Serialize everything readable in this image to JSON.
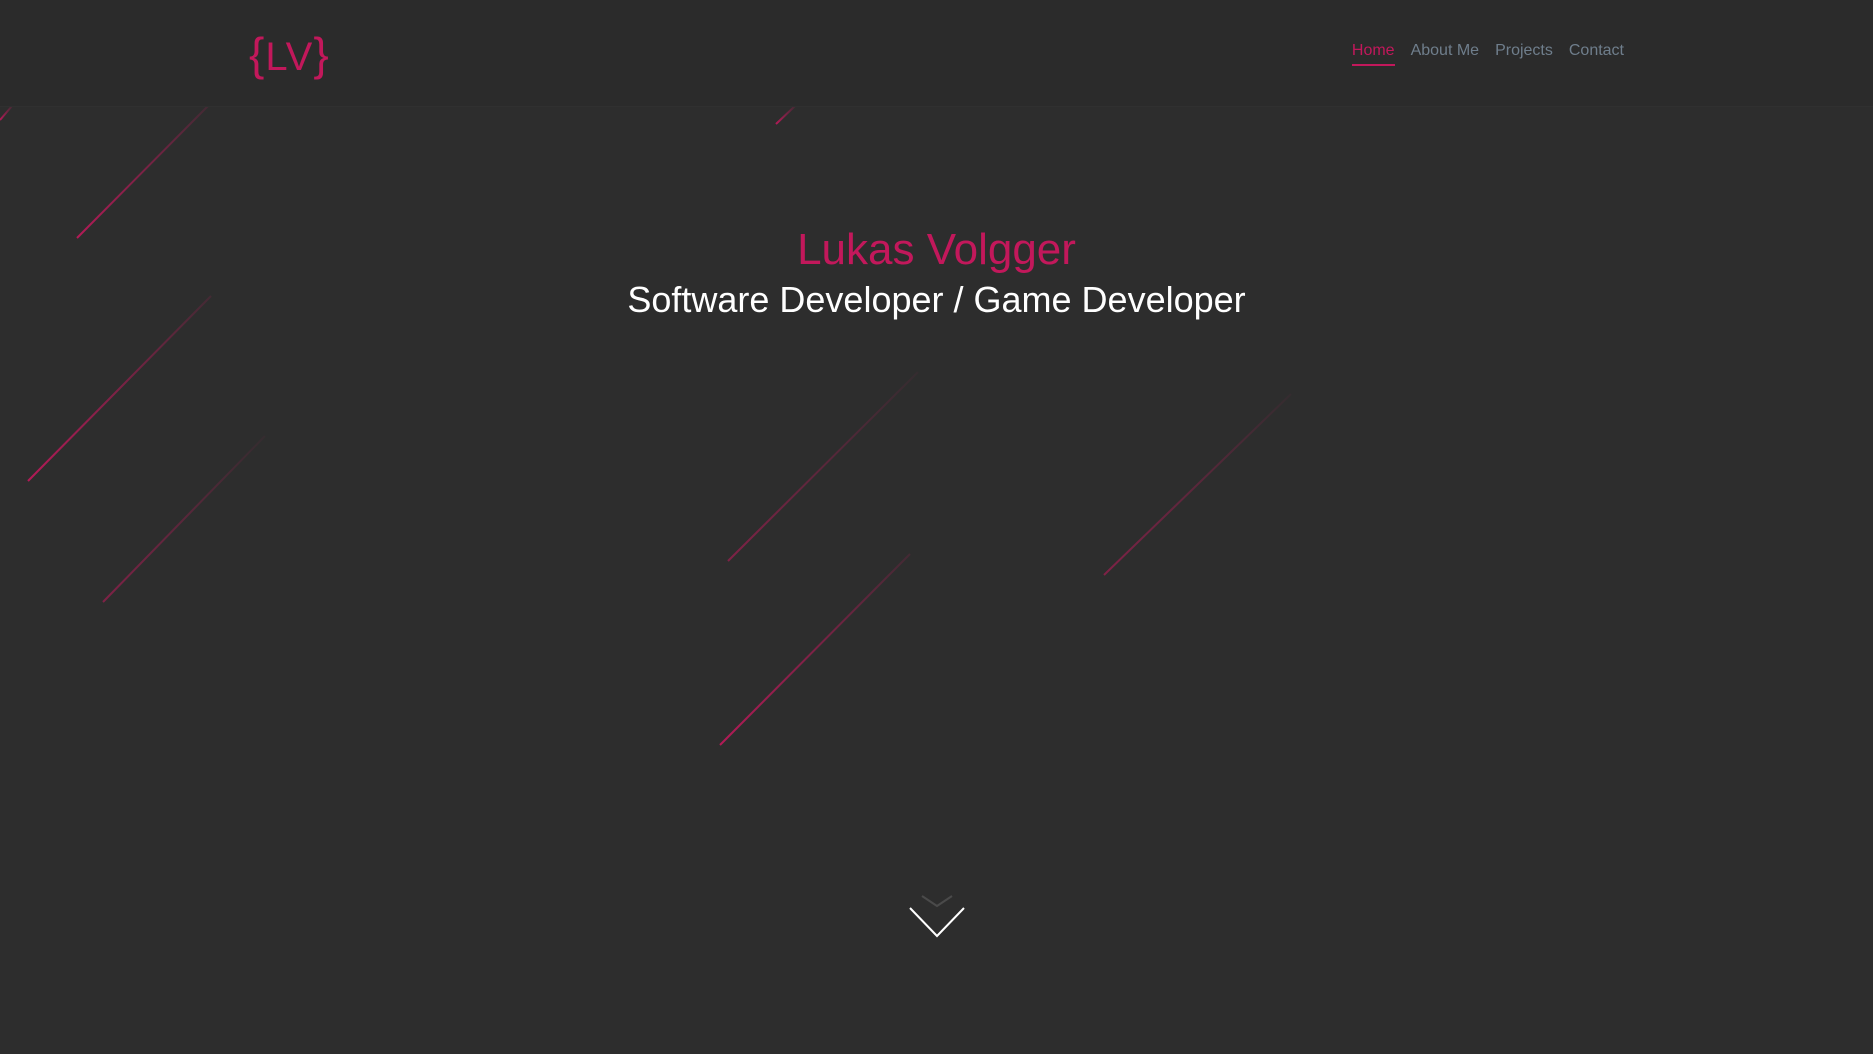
{
  "header": {
    "logo_open": "{",
    "logo_text": "LV",
    "logo_close": "}",
    "nav": {
      "home": "Home",
      "about": "About Me",
      "projects": "Projects",
      "contact": "Contact"
    }
  },
  "hero": {
    "name": "Lukas Volgger",
    "subtitle": "Software Developer / Game Developer"
  },
  "icons": {
    "scroll": "chevron-down-icon"
  },
  "colors": {
    "background": "#2d2d2d",
    "accent": "#c2185b",
    "nav_text": "#6f7e8c",
    "text": "#ffffff"
  }
}
